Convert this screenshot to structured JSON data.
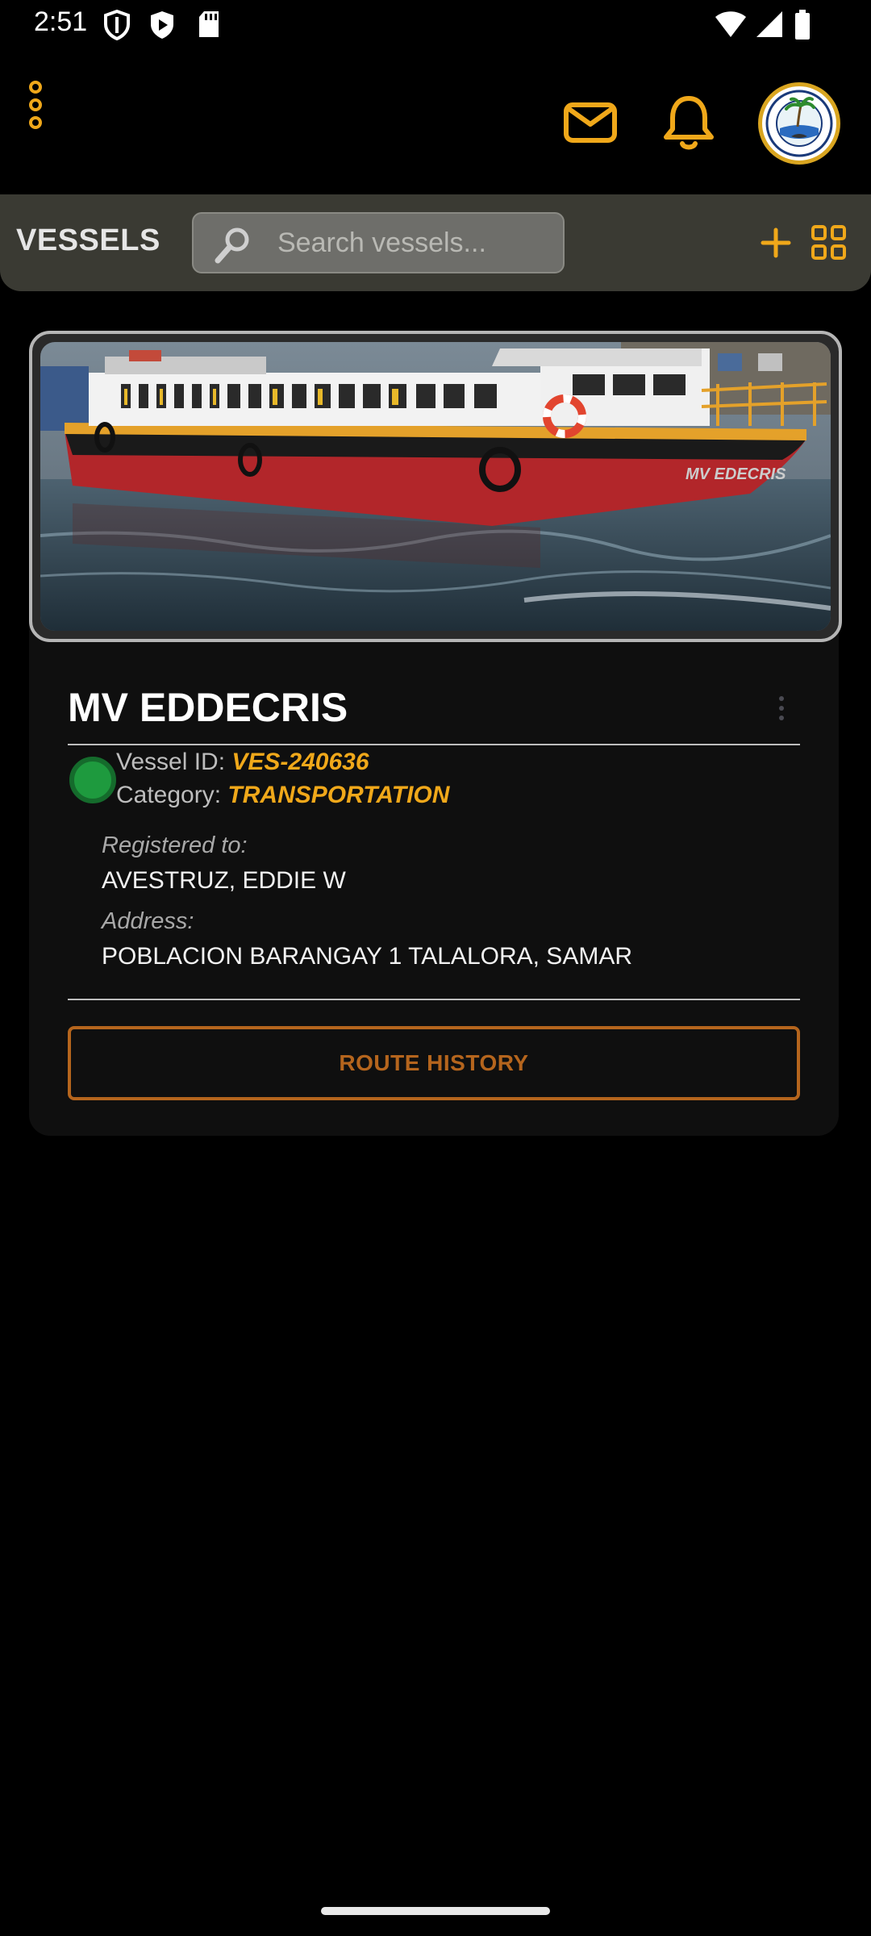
{
  "status_bar": {
    "time": "2:51"
  },
  "toolbar": {
    "title": "VESSELS",
    "search_placeholder": "Search vessels..."
  },
  "vessel": {
    "name": "MV EDDECRIS",
    "status_color": "#1e9a3e",
    "vessel_id_label": "Vessel ID:",
    "vessel_id": "VES-240636",
    "category_label": "Category:",
    "category": "TRANSPORTATION",
    "registered_label": "Registered to:",
    "registered_to": "AVESTRUZ, EDDIE W",
    "address_label": "Address:",
    "address": "POBLACION BARANGAY 1 TALALORA, SAMAR",
    "route_button": "ROUTE HISTORY"
  },
  "colors": {
    "accent": "#f0a81a",
    "button_border": "#b5651d",
    "toolbar_bg": "#3a3a33"
  },
  "icons": [
    "more-vert-icon",
    "mail-icon",
    "bell-icon",
    "avatar-logo",
    "search-icon",
    "add-icon",
    "grid-icon"
  ]
}
